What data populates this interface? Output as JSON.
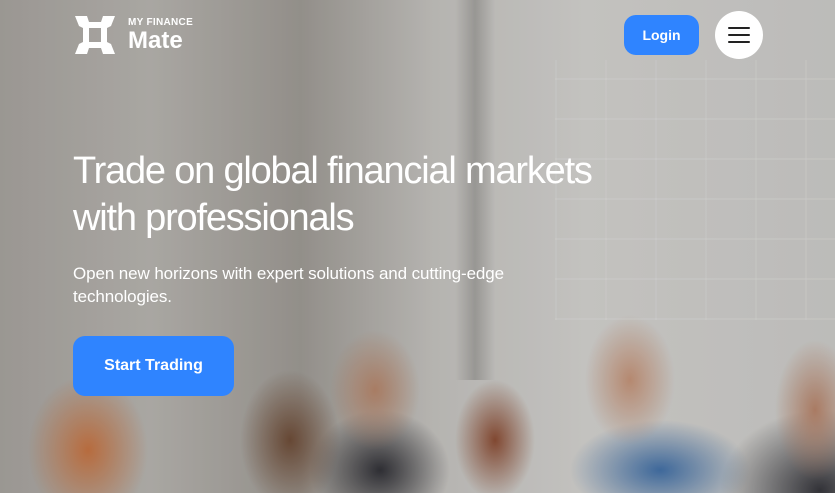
{
  "brand": {
    "tagline": "MY FINANCE",
    "name": "Mate",
    "logo_icon": "square-frame-logo-icon",
    "logo_color": "#ffffff"
  },
  "header": {
    "login_label": "Login",
    "menu_icon": "hamburger-menu-icon"
  },
  "hero": {
    "headline_line1": "Trade on global financial markets",
    "headline_line2": "with professionals",
    "subtitle_line1": "Open new horizons with expert solutions and cutting-edge",
    "subtitle_line2": "technologies.",
    "cta_label": "Start Trading"
  },
  "colors": {
    "accent": "#2f84ff",
    "text_on_image": "#ffffff"
  }
}
